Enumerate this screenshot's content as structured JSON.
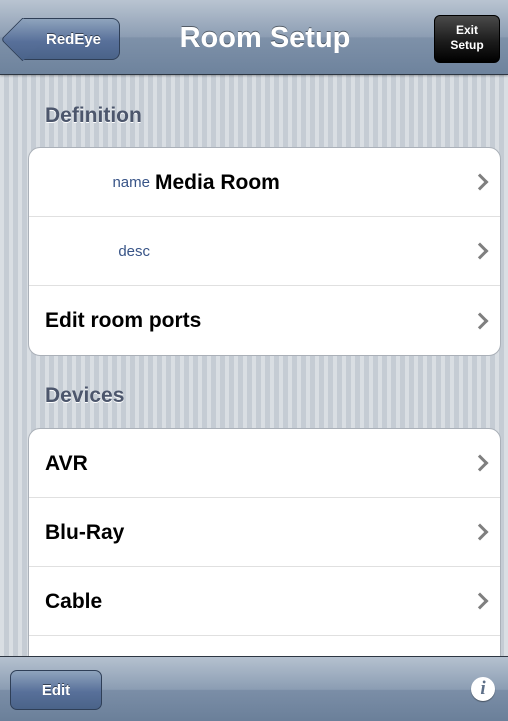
{
  "navbar": {
    "back_label": "RedEye",
    "title": "Room Setup",
    "exit_line1": "Exit",
    "exit_line2": "Setup"
  },
  "definition": {
    "header": "Definition",
    "name_key": "name",
    "name_value": "Media Room",
    "desc_key": "desc",
    "desc_value": "",
    "edit_ports_label": "Edit room ports"
  },
  "devices": {
    "header": "Devices",
    "items": [
      {
        "label": "AVR"
      },
      {
        "label": "Blu-Ray"
      },
      {
        "label": "Cable"
      },
      {
        "label": ""
      }
    ]
  },
  "toolbar": {
    "edit_label": "Edit",
    "info_glyph": "i"
  },
  "colors": {
    "nav_tint": "#7e91a9",
    "section_text": "#4c566c",
    "key_text": "#385487"
  },
  "icons": [
    "chevron-right-icon",
    "info-icon",
    "back-arrow-icon"
  ]
}
